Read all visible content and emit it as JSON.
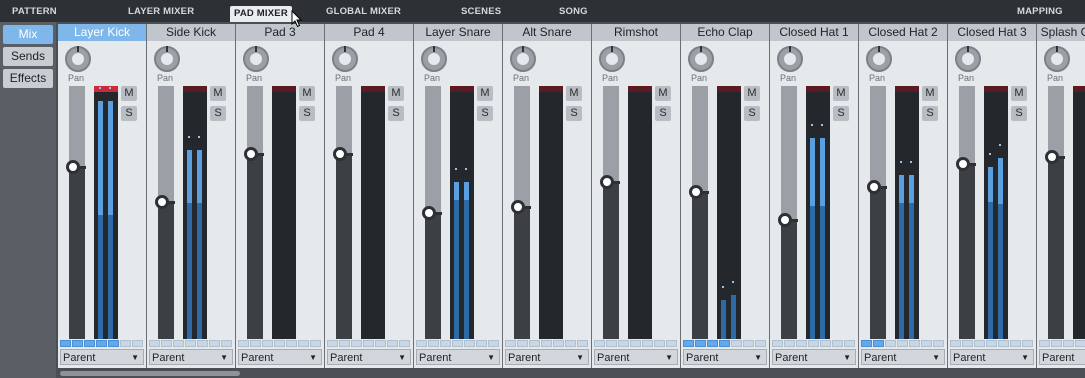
{
  "top_tabs": [
    {
      "label": "PATTERN",
      "active": false
    },
    {
      "label": "LAYER MIXER",
      "active": false
    },
    {
      "label": "PAD MIXER",
      "active": true
    },
    {
      "label": "GLOBAL MIXER",
      "active": false
    },
    {
      "label": "SCENES",
      "active": false
    },
    {
      "label": "SONG",
      "active": false
    },
    {
      "label": "MAPPING",
      "active": false
    }
  ],
  "side_tabs": [
    {
      "label": "Mix",
      "active": true
    },
    {
      "label": "Sends",
      "active": false
    },
    {
      "label": "Effects",
      "active": false
    }
  ],
  "common": {
    "pan_label": "Pan",
    "mute_label": "M",
    "solo_label": "S",
    "route_arrow": "▼"
  },
  "channels": [
    {
      "name": "Layer Kick",
      "selected": true,
      "output": "Parent",
      "fader_level": 0.32,
      "meter": [
        0.97,
        0.97
      ],
      "meter_hi": [
        0.45,
        0.45
      ],
      "peak_hot": true,
      "pads_lit": 5
    },
    {
      "name": "Side Kick",
      "selected": false,
      "output": "Parent",
      "fader_level": 0.46,
      "meter": [
        0.77,
        0.77
      ],
      "meter_hi": [
        0.21,
        0.21
      ],
      "peak_hot": false,
      "pads_lit": 0
    },
    {
      "name": "Pad 3",
      "selected": false,
      "output": "Parent",
      "fader_level": 0.27,
      "meter": [
        0,
        0
      ],
      "meter_hi": [
        0,
        0
      ],
      "peak_hot": false,
      "pads_lit": 0
    },
    {
      "name": "Pad 4",
      "selected": false,
      "output": "Parent",
      "fader_level": 0.27,
      "meter": [
        0,
        0
      ],
      "meter_hi": [
        0,
        0
      ],
      "peak_hot": false,
      "pads_lit": 0
    },
    {
      "name": "Layer Snare",
      "selected": false,
      "output": "Parent",
      "fader_level": 0.5,
      "meter": [
        0.64,
        0.64
      ],
      "meter_hi": [
        0.07,
        0.07
      ],
      "peak_hot": false,
      "pads_lit": 0
    },
    {
      "name": "Alt Snare",
      "selected": false,
      "output": "Parent",
      "fader_level": 0.48,
      "meter": [
        0,
        0
      ],
      "meter_hi": [
        0,
        0
      ],
      "peak_hot": false,
      "pads_lit": 0
    },
    {
      "name": "Rimshot",
      "selected": false,
      "output": "Parent",
      "fader_level": 0.38,
      "meter": [
        0,
        0
      ],
      "meter_hi": [
        0,
        0
      ],
      "peak_hot": false,
      "pads_lit": 0
    },
    {
      "name": "Echo Clap",
      "selected": false,
      "output": "Parent",
      "fader_level": 0.42,
      "meter": [
        0.16,
        0.18
      ],
      "meter_hi": [
        0,
        0
      ],
      "peak_hot": false,
      "pads_lit": 4
    },
    {
      "name": "Closed Hat 1",
      "selected": false,
      "output": "Parent",
      "fader_level": 0.53,
      "meter": [
        0.82,
        0.82
      ],
      "meter_hi": [
        0.27,
        0.27
      ],
      "peak_hot": false,
      "pads_lit": 0
    },
    {
      "name": "Closed Hat 2",
      "selected": false,
      "output": "Parent",
      "fader_level": 0.4,
      "meter": [
        0.67,
        0.67
      ],
      "meter_hi": [
        0.11,
        0.11
      ],
      "peak_hot": false,
      "pads_lit": 2
    },
    {
      "name": "Closed Hat 3",
      "selected": false,
      "output": "Parent",
      "fader_level": 0.31,
      "meter": [
        0.7,
        0.74
      ],
      "meter_hi": [
        0.14,
        0.18
      ],
      "peak_hot": false,
      "pads_lit": 0
    },
    {
      "name": "Splash Cymbal",
      "selected": false,
      "output": "Parent",
      "fader_level": 0.28,
      "meter": [
        0,
        0
      ],
      "meter_hi": [
        0,
        0
      ],
      "peak_hot": false,
      "pads_lit": 0
    }
  ],
  "colors": {
    "accent": "#7fb7ea",
    "meter_blue": "#5aa0e0",
    "peak_red": "#c92a3c"
  }
}
